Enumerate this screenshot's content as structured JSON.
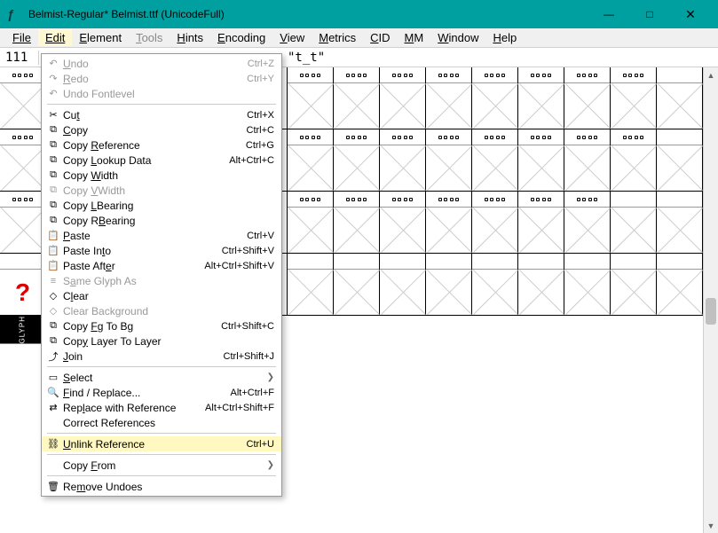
{
  "title": "Belmist-Regular*  Belmist.ttf (UnicodeFull)",
  "win": {
    "min": "—",
    "max": "□",
    "close": "✕"
  },
  "menubar": [
    "File",
    "Edit",
    "Element",
    "Tools",
    "Hints",
    "Encoding",
    "View",
    "Metrics",
    "CID",
    "MM",
    "Window",
    "Help"
  ],
  "info": {
    "num": "111",
    "text": "\"t_t\""
  },
  "dropdown": [
    {
      "icon": "↶",
      "label": "Undo",
      "shortcut": "Ctrl+Z",
      "u": 0,
      "disabled": true
    },
    {
      "icon": "↷",
      "label": "Redo",
      "shortcut": "Ctrl+Y",
      "u": 0,
      "disabled": true
    },
    {
      "icon": "↶",
      "label": "Undo Fontlevel",
      "disabled": true
    },
    {
      "sep": true
    },
    {
      "icon": "✂",
      "label": "Cut",
      "shortcut": "Ctrl+X",
      "u": 2
    },
    {
      "icon": "⧉",
      "label": "Copy",
      "shortcut": "Ctrl+C",
      "u": 0
    },
    {
      "icon": "⧉",
      "label": "Copy Reference",
      "shortcut": "Ctrl+G",
      "u": 5
    },
    {
      "icon": "⧉",
      "label": "Copy Lookup Data",
      "shortcut": "Alt+Ctrl+C",
      "u": 5
    },
    {
      "icon": "⧉",
      "label": "Copy Width",
      "u": 5
    },
    {
      "icon": "⧉",
      "label": "Copy VWidth",
      "u": 5,
      "disabled": true
    },
    {
      "icon": "⧉",
      "label": "Copy LBearing",
      "u": 5
    },
    {
      "icon": "⧉",
      "label": "Copy RBearing",
      "u": 6
    },
    {
      "icon": "📋",
      "label": "Paste",
      "shortcut": "Ctrl+V",
      "u": 0
    },
    {
      "icon": "📋",
      "label": "Paste Into",
      "shortcut": "Ctrl+Shift+V",
      "u": 8
    },
    {
      "icon": "📋",
      "label": "Paste After",
      "shortcut": "Alt+Ctrl+Shift+V",
      "u": 9
    },
    {
      "icon": "≡",
      "label": "Same Glyph As",
      "u": 1,
      "disabled": true
    },
    {
      "icon": "◇",
      "label": "Clear",
      "u": 1
    },
    {
      "icon": "◇",
      "label": "Clear Background",
      "disabled": true
    },
    {
      "icon": "⧉",
      "label": "Copy Fg To Bg",
      "shortcut": "Ctrl+Shift+C",
      "u": 5
    },
    {
      "icon": "⧉",
      "label": "Copy Layer To Layer",
      "u": 3
    },
    {
      "icon": "⤴",
      "label": "Join",
      "shortcut": "Ctrl+Shift+J",
      "u": 0
    },
    {
      "sep": true
    },
    {
      "icon": "▭",
      "label": "Select",
      "u": 0,
      "submenu": true
    },
    {
      "icon": "🔍",
      "label": "Find / Replace...",
      "shortcut": "Alt+Ctrl+F",
      "u": 0
    },
    {
      "icon": "⇄",
      "label": "Replace with Reference",
      "shortcut": "Alt+Ctrl+Shift+F",
      "u": 3
    },
    {
      "icon": "",
      "label": "Correct References"
    },
    {
      "sep": true
    },
    {
      "icon": "⛓",
      "label": "Unlink Reference",
      "shortcut": "Ctrl+U",
      "u": 0,
      "highlighted": true
    },
    {
      "sep": true
    },
    {
      "icon": "",
      "label": "Copy From",
      "u": 5,
      "submenu": true
    },
    {
      "sep": true
    },
    {
      "icon": "🗑",
      "label": "Remove Undoes",
      "u": 2
    }
  ],
  "glyph_label": "GLYPH"
}
